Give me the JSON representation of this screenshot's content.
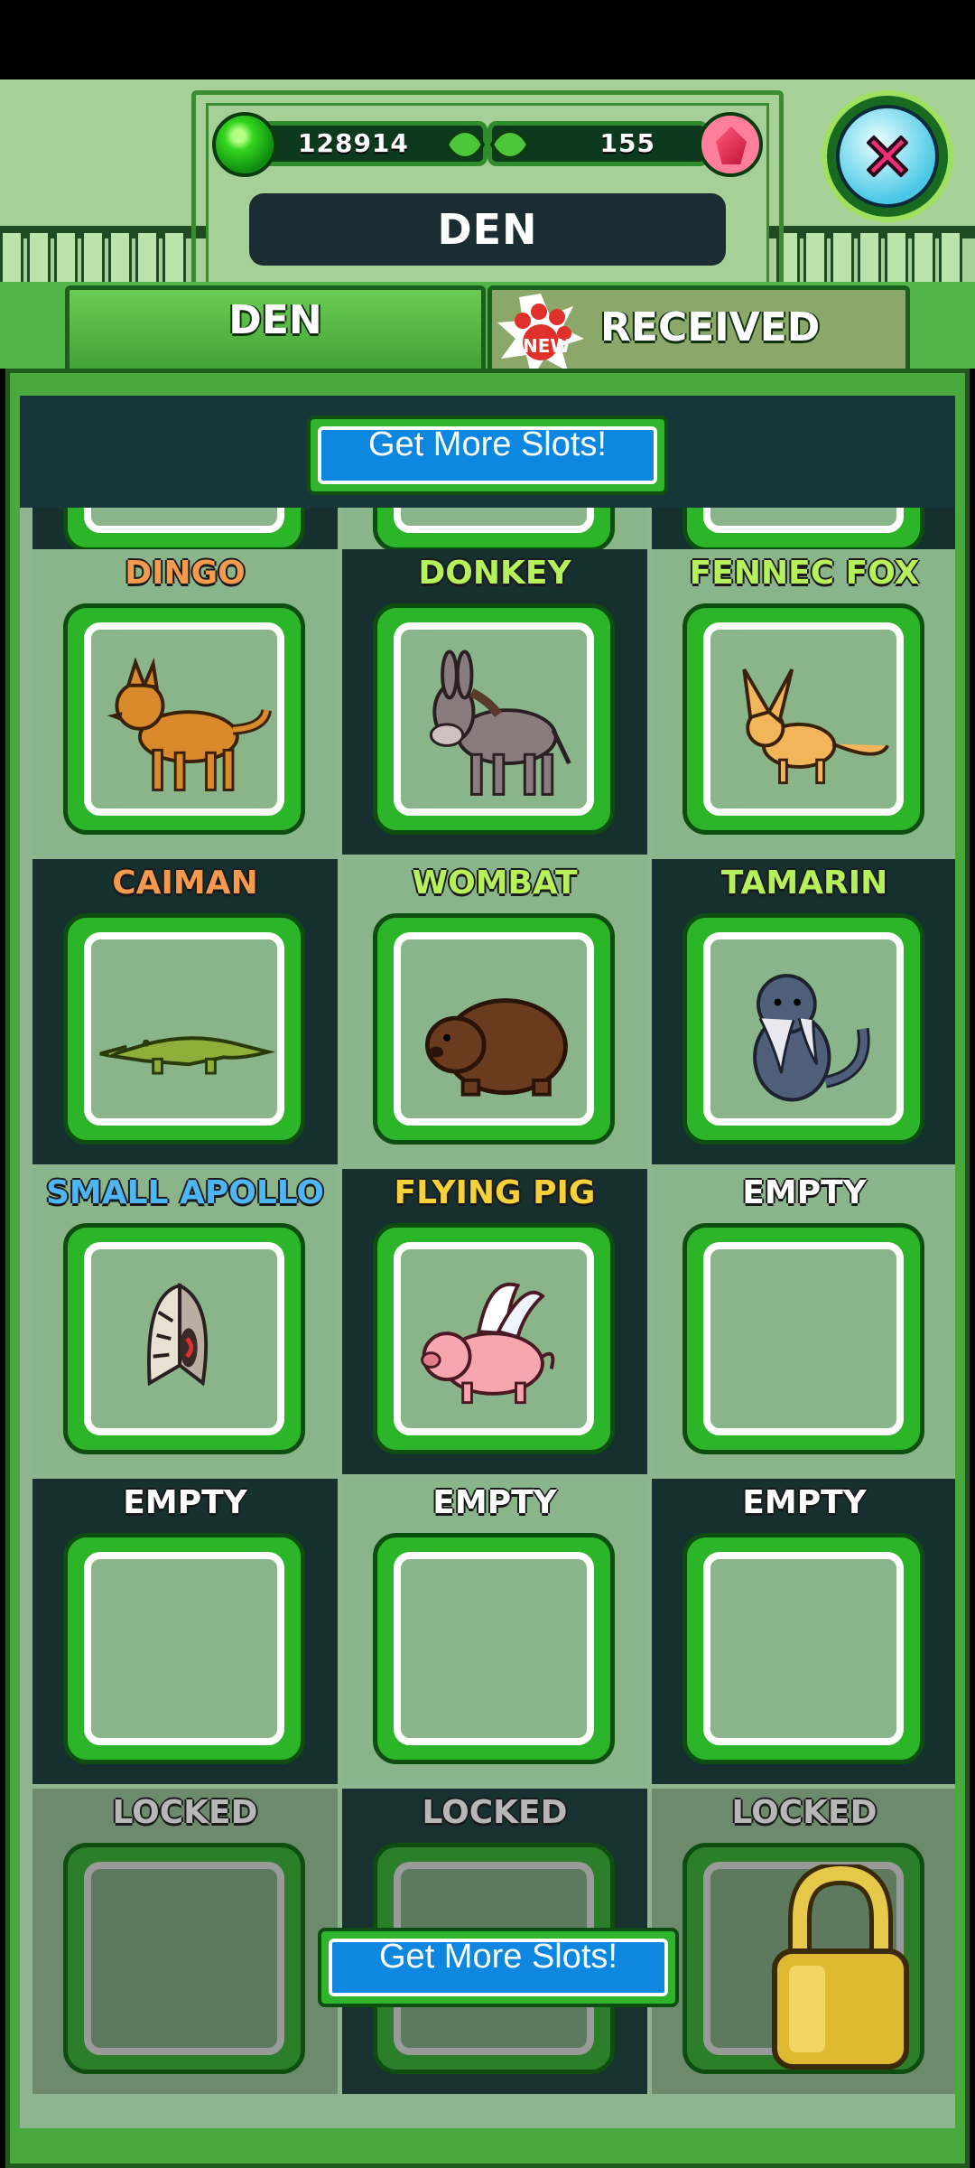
{
  "header": {
    "currency_green": "128914",
    "currency_red": "155",
    "title": "DEN",
    "close_icon": "close-x-icon"
  },
  "tabs": {
    "den": "DEN",
    "received": "RECEIVED",
    "new_badge": "NEW"
  },
  "buttons": {
    "get_more_slots_top": "Get More Slots!",
    "get_more_slots_bottom": "Get More Slots!"
  },
  "slots": [
    {
      "label": "DINGO",
      "color": "#f39a4f",
      "animal": "dingo"
    },
    {
      "label": "DONKEY",
      "color": "#b6f05a",
      "animal": "donkey"
    },
    {
      "label": "FENNEC FOX",
      "color": "#b6f05a",
      "animal": "fennec-fox"
    },
    {
      "label": "CAIMAN",
      "color": "#f39a4f",
      "animal": "caiman"
    },
    {
      "label": "WOMBAT",
      "color": "#b6f05a",
      "animal": "wombat"
    },
    {
      "label": "TAMARIN",
      "color": "#b6f05a",
      "animal": "tamarin"
    },
    {
      "label": "SMALL APOLLO",
      "color": "#4fb6f5",
      "animal": "small-apollo"
    },
    {
      "label": "FLYING PIG",
      "color": "#f5d23a",
      "animal": "flying-pig"
    },
    {
      "label": "EMPTY",
      "color": "#ffffff",
      "animal": ""
    },
    {
      "label": "EMPTY",
      "color": "#ffffff",
      "animal": ""
    },
    {
      "label": "EMPTY",
      "color": "#ffffff",
      "animal": ""
    },
    {
      "label": "EMPTY",
      "color": "#ffffff",
      "animal": ""
    },
    {
      "label": "LOCKED",
      "color": "#b7b7b7",
      "animal": ""
    },
    {
      "label": "LOCKED",
      "color": "#b7b7b7",
      "animal": ""
    },
    {
      "label": "LOCKED",
      "color": "#b7b7b7",
      "animal": ""
    }
  ]
}
